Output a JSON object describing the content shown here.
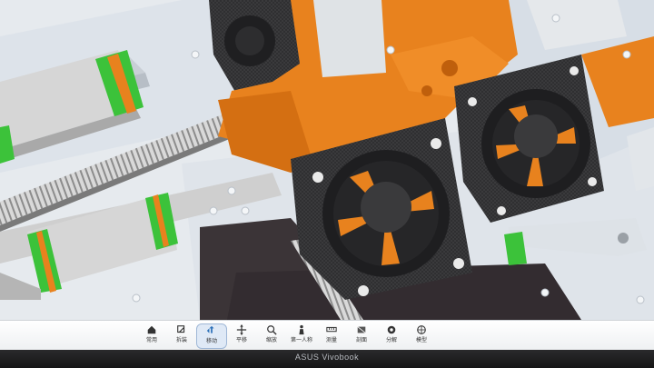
{
  "app": {
    "toolbar": {
      "items": [
        {
          "label": "常用",
          "icon": "home-icon"
        },
        {
          "label": "拆装",
          "icon": "disassemble-icon"
        },
        {
          "label": "移动",
          "icon": "rotate-icon"
        },
        {
          "label": "平移",
          "icon": "pan-icon"
        },
        {
          "label": "缩放",
          "icon": "zoom-icon"
        },
        {
          "label": "第一人称",
          "icon": "first-person-icon"
        },
        {
          "label": "测量",
          "icon": "measure-icon"
        },
        {
          "label": "剖面",
          "icon": "section-icon"
        },
        {
          "label": "分解",
          "icon": "explode-icon"
        },
        {
          "label": "模型",
          "icon": "model-icon"
        }
      ],
      "active_index": 2
    }
  },
  "device": {
    "brand": "ASUS Vivobook"
  },
  "colors": {
    "accent_orange": "#e8821e",
    "fan_black": "#2b2b2d",
    "rail_green": "#3cc23a",
    "frame_gray": "#cfd6de"
  }
}
